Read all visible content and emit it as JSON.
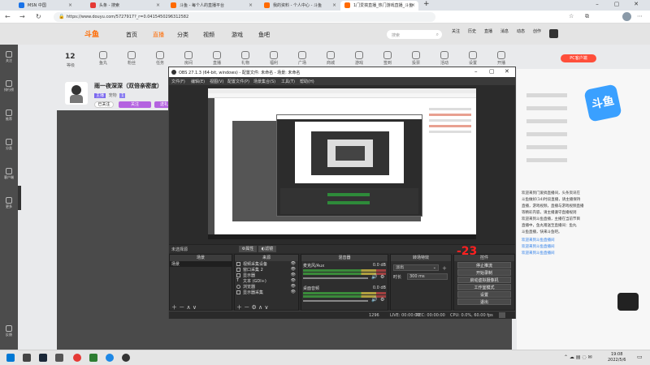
{
  "browser": {
    "tabs": [
      {
        "label": "MSN 中国",
        "color": "#1a73e8"
      },
      {
        "label": "头条 - 搜索",
        "color": "#e53935"
      },
      {
        "label": "斗鱼 - 每个人的直播平台",
        "color": "#ff6a00"
      },
      {
        "label": "我的资料 - 个人中心 - 斗鱼",
        "color": "#ff6a00"
      },
      {
        "label": "1门爱搞直播_热门游戏直播_斗鱼",
        "color": "#ff6a00"
      }
    ],
    "new_tab": "+",
    "url": "https://www.douyu.com/5727917?_r=0.0415450296312582"
  },
  "site": {
    "logo": "斗鱼",
    "nav": [
      "首页",
      "直播",
      "分类",
      "视频",
      "游戏",
      "鱼吧"
    ],
    "search_placeholder": "搜索",
    "header_icons": [
      "关注",
      "历史",
      "直播",
      "消息",
      "动态",
      "创作"
    ],
    "level_value": "12",
    "level_label": "等级",
    "stats": [
      "鱼丸",
      "粉丝",
      "任务",
      "房间",
      "直播",
      "礼物",
      "福利",
      "广场",
      "商城",
      "游戏",
      "签到",
      "投票",
      "活动",
      "设置",
      "开播"
    ],
    "room_title": "雨一夜深深（双倍亲密度）",
    "streamer_tags": [
      "主播",
      "宠物",
      "1",
      "关注",
      "送礼"
    ],
    "follow_label": "已关注",
    "pc_label": "PC客户端",
    "rail": [
      "关注",
      "排行榜",
      "推荐",
      "分类",
      "客户端",
      "更多",
      "反馈"
    ],
    "right_text": [
      "欢迎来到门爱搞直播间，头条资讯在",
      "斗鱼做好(14)时段直播，请主播保持",
      "直播，游戏视频，直播与游戏视频直播",
      "等精彩内容，请主播遵守直播规则",
      "欢迎来到斗鱼直播，主播在当前节目",
      "直播中，鱼丸赠送至直播间：鱼丸",
      "斗鱼直播，快来斗鱼吧。"
    ],
    "right_links": [
      "欢迎来到斗鱼直播间",
      "欢迎来到斗鱼直播间",
      "欢迎来到斗鱼直播间"
    ]
  },
  "obs": {
    "title": "OBS 27.1.3 (64-bit, windows) - 配置文件: 未命名 - 场景: 未命名",
    "menu": [
      "文件(F)",
      "编辑(E)",
      "视图(V)",
      "配置文件(P)",
      "场景集合(S)",
      "工具(T)",
      "帮助(H)"
    ],
    "source_bar": "未选择源",
    "props_btn": "属性",
    "filters_btn": "滤镜",
    "docks": {
      "scenes": {
        "title": "场景",
        "items": [
          "场景"
        ]
      },
      "sources": {
        "title": "来源",
        "items": [
          "视频采集设备",
          "窗口采集 2",
          "显示器",
          "文本 (GDI+)",
          "浏览器",
          "显示器采集"
        ]
      },
      "mixer": {
        "title": "混音器",
        "channels": [
          {
            "name": "麦克风/Aux",
            "db": "0.0 dB"
          },
          {
            "name": "桌面音频",
            "db": "0.0 dB"
          }
        ]
      },
      "transitions": {
        "title": "转场特效",
        "mode": "淡出",
        "duration_label": "时长",
        "duration": "300 ms"
      },
      "controls": {
        "title": "控件",
        "buttons": [
          "停止推流",
          "开始录制",
          "启动虚拟摄像机",
          "工作室模式",
          "设置",
          "退出"
        ]
      }
    },
    "badge": "-23",
    "status": {
      "live": "LIVE: 00:00:00",
      "rec": "REC: 00:00:00",
      "cpu": "CPU: 0.0%, 60.00 fps",
      "kb": "1296"
    }
  },
  "taskbar": {
    "time": "19:08",
    "date": "2022/5/6"
  },
  "colors": {
    "douyu": "#ff6a00",
    "obs_bg": "#2a2a2a",
    "badge": "#ff2020",
    "accent": "#1a73e8"
  }
}
